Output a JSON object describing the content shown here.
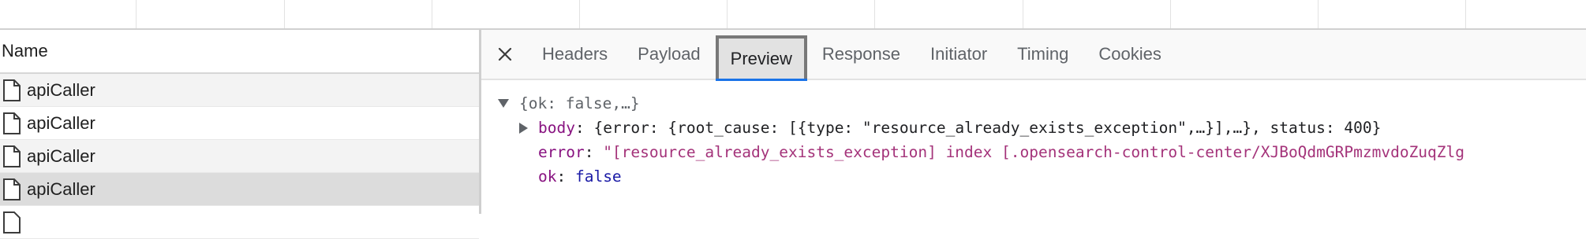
{
  "request_list": {
    "column_header": "Name",
    "rows": [
      {
        "name": "apiCaller"
      },
      {
        "name": "apiCaller"
      },
      {
        "name": "apiCaller"
      },
      {
        "name": "apiCaller"
      }
    ]
  },
  "detail": {
    "close_icon": "close-icon",
    "tabs": [
      "Headers",
      "Payload",
      "Preview",
      "Response",
      "Initiator",
      "Timing",
      "Cookies"
    ],
    "active_tab": "Preview",
    "preview": {
      "root_summary": "{ok: false,…}",
      "body_key": "body",
      "body_value": "{error: {root_cause: [{type: \"resource_already_exists_exception\",…}],…}, status: 400}",
      "error_key": "error",
      "error_value": "\"[resource_already_exists_exception] index [.opensearch-control-center/XJBoQdmGRPmzmvdoZuqZlg",
      "ok_key": "ok",
      "ok_value": "false"
    }
  },
  "colors": {
    "accent": "#1a73e8",
    "key": "#881280",
    "string": "#a4337a",
    "boolean": "#1a1aa6"
  }
}
